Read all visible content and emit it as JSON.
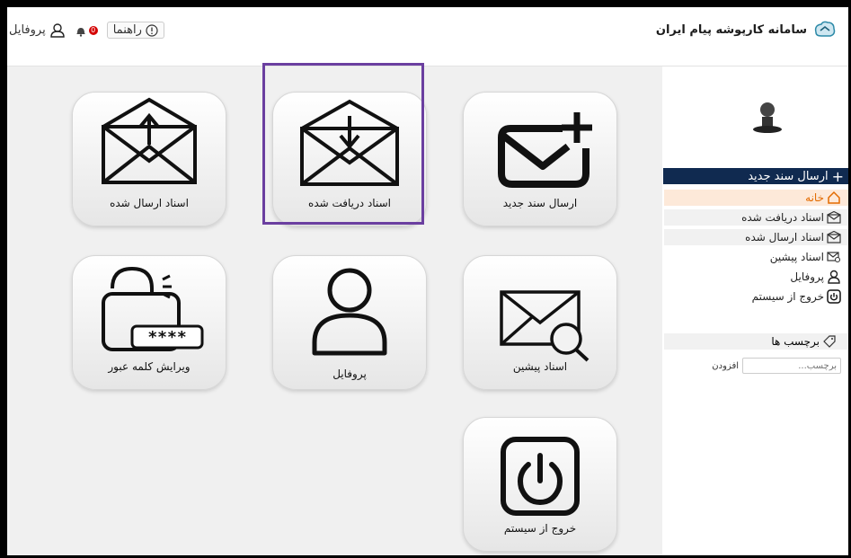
{
  "header": {
    "brand_text": "سامانه کارپوشه پیام ایران",
    "help_label": "راهنما",
    "notif_count": "0",
    "profile_label": "پروفایل"
  },
  "sidebar": {
    "new_doc_label": "ارسال سند جدید",
    "items": [
      {
        "label": "خانه",
        "icon": "home-icon"
      },
      {
        "label": "اسناد دریافت شده",
        "icon": "envelope-in-icon"
      },
      {
        "label": "اسناد ارسال شده",
        "icon": "envelope-out-icon"
      },
      {
        "label": "اسناد پیشین",
        "icon": "envelope-search-icon"
      },
      {
        "label": "پروفایل",
        "icon": "user-icon"
      },
      {
        "label": "خروج از سیستم",
        "icon": "power-icon"
      }
    ],
    "tags_label": "برچسب ها",
    "tag_placeholder": "برچسب...",
    "tag_add_label": "افزودن"
  },
  "tiles": {
    "new_doc": "ارسال سند جدید",
    "received": "اسناد دریافت شده",
    "sent": "اسناد ارسال شده",
    "previous": "اسناد پیشین",
    "profile": "پروفایل",
    "change_password": "ویرایش کلمه عبور",
    "password_mask": "****",
    "logout": "خروج از سیستم"
  },
  "colors": {
    "sidebar_header_bg": "#102a50",
    "active_bg": "#fde9d9",
    "active_text": "#e36b00",
    "highlight": "#6b3fa0"
  }
}
